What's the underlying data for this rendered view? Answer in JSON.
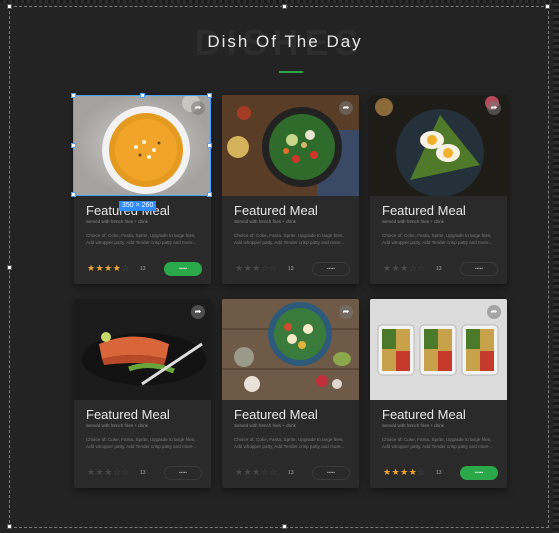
{
  "header": {
    "ghost_text": "DISHES",
    "title": "Dish Of The Day"
  },
  "selection": {
    "size_label": "350 × 260"
  },
  "colors": {
    "accent": "#2aa84a",
    "star": "#f0a530",
    "selection": "#47a3ff"
  },
  "cards": [
    {
      "title": "Featured Meal",
      "subtitle": "Served with french fries + drink",
      "desc": "Choice of: Coke, Fanta, Sprite, Upgrade to large fries, Add whopper patty, Add Tender crisp patty and more...",
      "rating": 3.5,
      "stars": "★★★☆☆",
      "count": "13",
      "button": "•••••",
      "active": true
    },
    {
      "title": "Featured Meal",
      "subtitle": "Served with french fries + drink",
      "desc": "Choice of: Coke, Fanta, Sprite, Upgrade to large fries, Add whopper patty, Add Tender crisp patty and more...",
      "rating": 3,
      "stars": "★★★☆☆",
      "count": "13",
      "button": "•••••",
      "active": false
    },
    {
      "title": "Featured Meal",
      "subtitle": "Served with french fries + drink",
      "desc": "Choice of: Coke, Fanta, Sprite, Upgrade to large fries, Add whopper patty, Add Tender crisp patty and more...",
      "rating": 3,
      "stars": "★★★☆☆",
      "count": "13",
      "button": "•••••",
      "active": false
    },
    {
      "title": "Featured Meal",
      "subtitle": "Served with french fries + drink",
      "desc": "Choice of: Coke, Fanta, Sprite, Upgrade to large fries, Add whopper patty, Add Tender crisp patty and more...",
      "rating": 3,
      "stars": "★★★☆☆",
      "count": "13",
      "button": "•••••",
      "active": false
    },
    {
      "title": "Featured Meal",
      "subtitle": "Served with french fries + drink",
      "desc": "Choice of: Coke, Fanta, Sprite, Upgrade to large fries, Add whopper patty, Add Tender crisp patty and more...",
      "rating": 3,
      "stars": "★★★☆☆",
      "count": "13",
      "button": "•••••",
      "active": false
    },
    {
      "title": "Featured Meal",
      "subtitle": "Served with french fries + drink",
      "desc": "Choice of: Coke, Fanta, Sprite, Upgrade to large fries, Add whopper patty, Add Tender crisp patty and more...",
      "rating": 3.5,
      "stars": "★★★☆☆",
      "count": "13",
      "button": "•••••",
      "active": true
    }
  ]
}
